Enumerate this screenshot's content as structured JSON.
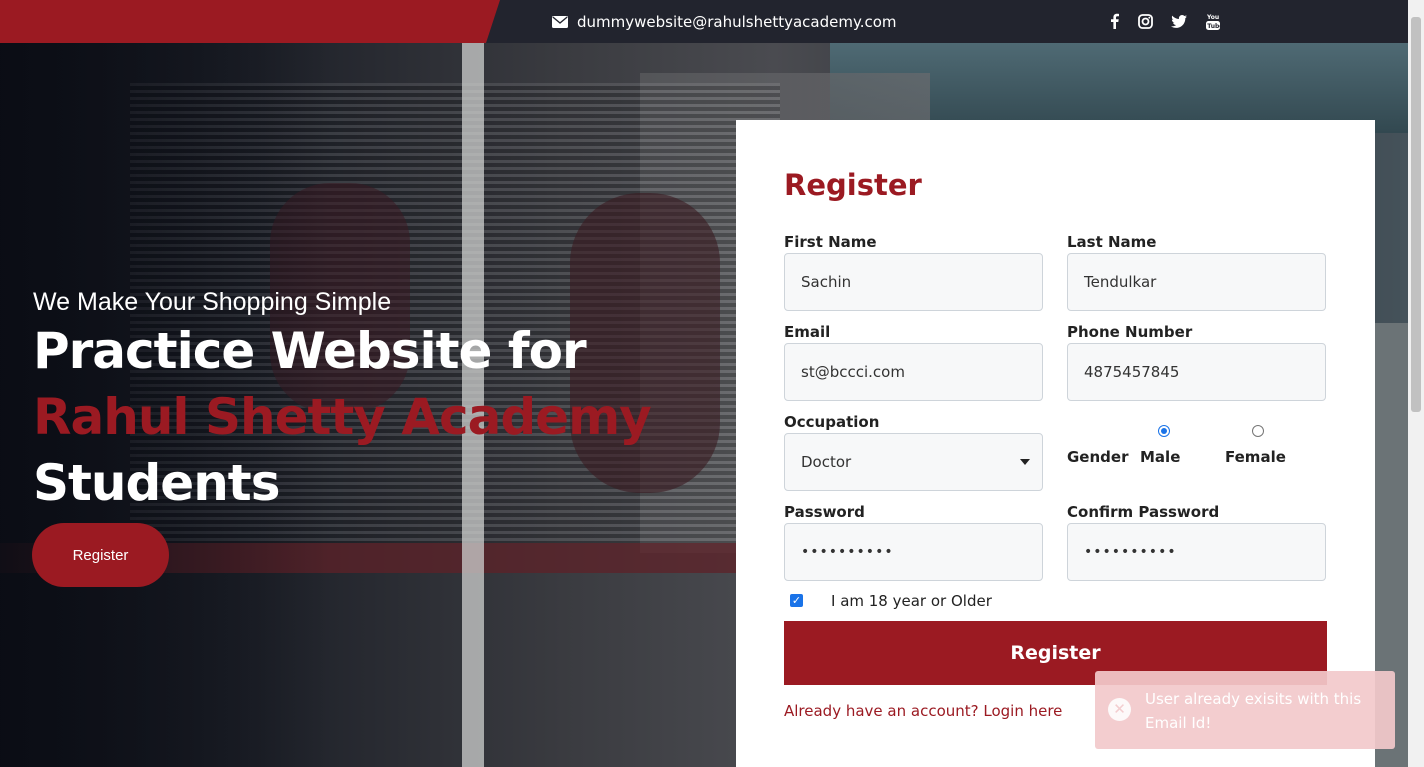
{
  "topbar": {
    "email": "dummywebsite@rahulshettyacademy.com",
    "social_icons": [
      "facebook-icon",
      "instagram-icon",
      "twitter-icon",
      "youtube-icon"
    ]
  },
  "hero": {
    "tagline": "We Make Your Shopping Simple",
    "headline_line1": "Practice Website for",
    "headline_line2": "Rahul Shetty Academy",
    "headline_line3": "Students",
    "button_label": "Register"
  },
  "form": {
    "title": "Register",
    "first_name": {
      "label": "First Name",
      "value": "Sachin"
    },
    "last_name": {
      "label": "Last Name",
      "value": "Tendulkar"
    },
    "email": {
      "label": "Email",
      "value": "st@bccci.com"
    },
    "phone": {
      "label": "Phone Number",
      "value": "4875457845"
    },
    "occupation": {
      "label": "Occupation",
      "value": "Doctor"
    },
    "gender": {
      "label": "Gender",
      "options": [
        "Male",
        "Female"
      ],
      "selected": "Male"
    },
    "password": {
      "label": "Password",
      "value": "••••••••••"
    },
    "confirm_password": {
      "label": "Confirm Password",
      "value": "••••••••••"
    },
    "age_check": {
      "label": "I am 18 year or Older",
      "checked": true
    },
    "submit_label": "Register",
    "login_link": "Already have an account? Login here"
  },
  "toast": {
    "message": "User already exisits with this Email Id!"
  },
  "colors": {
    "brand_red": "#9b1a22",
    "topbar_dark": "#22242e",
    "toast_bg": "#f3c9cb"
  }
}
